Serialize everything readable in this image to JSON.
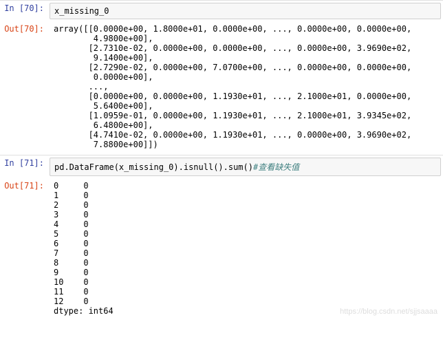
{
  "cell1": {
    "in_prompt": "In  [70]:",
    "out_prompt": "Out[70]:",
    "code": "x_missing_0",
    "output": "array([[0.0000e+00, 1.8000e+01, 0.0000e+00, ..., 0.0000e+00, 0.0000e+00,\n        4.9800e+00],\n       [2.7310e-02, 0.0000e+00, 0.0000e+00, ..., 0.0000e+00, 3.9690e+02,\n        9.1400e+00],\n       [2.7290e-02, 0.0000e+00, 7.0700e+00, ..., 0.0000e+00, 0.0000e+00,\n        0.0000e+00],\n       ...,\n       [0.0000e+00, 0.0000e+00, 1.1930e+01, ..., 2.1000e+01, 0.0000e+00,\n        5.6400e+00],\n       [1.0959e-01, 0.0000e+00, 1.1930e+01, ..., 2.1000e+01, 3.9345e+02,\n        6.4800e+00],\n       [4.7410e-02, 0.0000e+00, 1.1930e+01, ..., 0.0000e+00, 3.9690e+02,\n        7.8800e+00]])"
  },
  "cell2": {
    "in_prompt": "In  [71]:",
    "out_prompt": "Out[71]:",
    "code": "pd.DataFrame(x_missing_0).isnull().sum()",
    "comment": "#查看缺失值",
    "output": "0     0\n1     0\n2     0\n3     0\n4     0\n5     0\n6     0\n7     0\n8     0\n9     0\n10    0\n11    0\n12    0\ndtype: int64"
  },
  "watermark": "https://blog.csdn.net/sjjsaaaa"
}
